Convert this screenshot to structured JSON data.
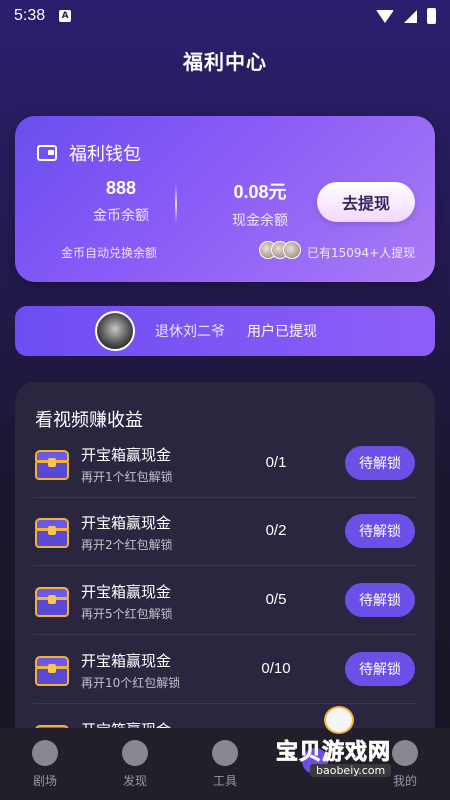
{
  "status": {
    "time": "5:38",
    "notif_icon": "A"
  },
  "page_title": "福利中心",
  "wallet": {
    "title": "福利钱包",
    "coins_value": "888",
    "coins_label": "金币余额",
    "cash_value": "0.08元",
    "cash_label": "现金余额",
    "withdraw_label": "去提现",
    "auto_note": "金币自动兑换余额",
    "withdrawn_count": "已有15094+人提现"
  },
  "ticker": {
    "name": "退休刘二爷",
    "action": "用户已提现"
  },
  "earn": {
    "title": "看视频赚收益",
    "tasks": [
      {
        "name": "开宝箱赢现金",
        "sub": "再开1个红包解锁",
        "progress": "0/1",
        "button": "待解锁"
      },
      {
        "name": "开宝箱赢现金",
        "sub": "再开2个红包解锁",
        "progress": "0/2",
        "button": "待解锁"
      },
      {
        "name": "开宝箱赢现金",
        "sub": "再开5个红包解锁",
        "progress": "0/5",
        "button": "待解锁"
      },
      {
        "name": "开宝箱赢现金",
        "sub": "再开10个红包解锁",
        "progress": "0/10",
        "button": "待解锁"
      },
      {
        "name": "开宝箱赢现金",
        "sub": "",
        "progress": "",
        "button": ""
      }
    ]
  },
  "tabs": [
    {
      "label": "剧场",
      "icon": "film-reel-icon"
    },
    {
      "label": "发现",
      "icon": "planet-icon"
    },
    {
      "label": "工具",
      "icon": "aperture-icon"
    },
    {
      "label": "",
      "icon": "gift-icon"
    },
    {
      "label": "我的",
      "icon": "profile-icon"
    }
  ],
  "watermark": {
    "text": "宝贝游戏网",
    "url": "baobeiy.com"
  }
}
